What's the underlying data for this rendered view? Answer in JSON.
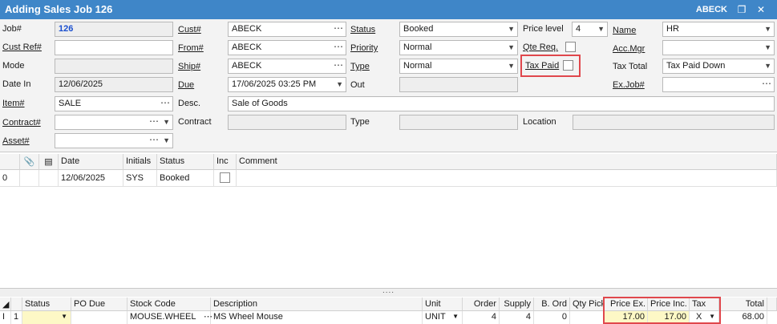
{
  "window": {
    "title": "Adding Sales Job 126",
    "user": "ABECK"
  },
  "form": {
    "job_label": "Job#",
    "job_value": "126",
    "custref_label": "Cust Ref#",
    "custref_value": "",
    "mode_label": "Mode",
    "mode_value": "",
    "datein_label": "Date In",
    "datein_value": "12/06/2025",
    "item_label": "Item#",
    "item_value": "SALE",
    "contract_label": "Contract#",
    "contract_value": "",
    "asset_label": "Asset#",
    "asset_value": "",
    "cust_label": "Cust#",
    "cust_value": "ABECK",
    "from_label": "From#",
    "from_value": "ABECK",
    "ship_label": "Ship#",
    "ship_value": "ABECK",
    "due_label": "Due",
    "due_value": "17/06/2025 03:25 PM",
    "desc_label": "Desc.",
    "desc_value": "Sale of Goods",
    "contract2_label": "Contract",
    "contract2_value": "",
    "status_label": "Status",
    "status_value": "Booked",
    "priority_label": "Priority",
    "priority_value": "Normal",
    "type_label": "Type",
    "type_value": "Normal",
    "out_label": "Out",
    "out_value": "",
    "type2_label": "Type",
    "type2_value": "",
    "pricelevel_label": "Price level",
    "pricelevel_value": "4",
    "qtereq_label": "Qte Req.",
    "taxpaid_label": "Tax Paid",
    "location_label": "Location",
    "location_value": "",
    "name_label": "Name",
    "name_value": "HR",
    "accmgr_label": "Acc.Mgr",
    "accmgr_value": "",
    "taxtotal_label": "Tax Total",
    "taxtotal_value": "Tax Paid Down",
    "exjob_label": "Ex.Job#",
    "exjob_value": ""
  },
  "history_grid": {
    "headers": [
      "Date",
      "Initials",
      "Status",
      "Inc",
      "Comment"
    ],
    "rows": [
      {
        "index": "0",
        "date": "12/06/2025",
        "initials": "SYS",
        "status": "Booked",
        "comment": ""
      }
    ]
  },
  "lines_grid": {
    "headers": [
      "Status",
      "PO Due",
      "Stock Code",
      "Description",
      "Unit",
      "Order",
      "Supply",
      "B. Ord",
      "Qty Pick",
      "Price Ex.",
      "Price Inc.",
      "Tax",
      "Total"
    ],
    "rows": [
      {
        "index": "1",
        "status": "",
        "po_due": "",
        "stock_code": "MOUSE.WHEEL",
        "description": "MS Wheel Mouse",
        "unit": "UNIT",
        "order": "4",
        "supply": "4",
        "b_ord": "0",
        "qty_pick": "",
        "price_ex": "17.00",
        "price_inc": "17.00",
        "tax": "X",
        "total": "68.00"
      }
    ]
  },
  "colors": {
    "titlebar": "#3f86c8",
    "highlight": "#e0474c",
    "editable_cell": "#fdf8c6"
  }
}
